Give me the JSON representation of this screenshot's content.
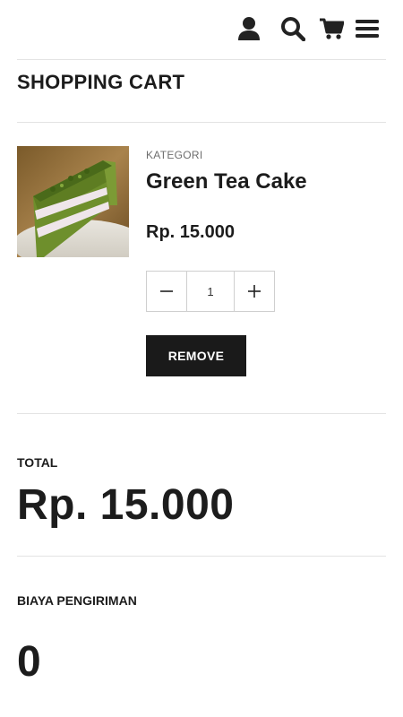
{
  "header": {
    "icons": [
      "user-icon",
      "search-icon",
      "cart-icon",
      "menu-icon"
    ]
  },
  "page_title": "SHOPPING CART",
  "cart_item": {
    "category": "KATEGORI",
    "name": "Green Tea Cake",
    "price": "Rp. 15.000",
    "quantity": "1",
    "remove_label": "REMOVE"
  },
  "summary": {
    "total_label": "TOTAL",
    "total_value": "Rp. 15.000",
    "shipping_label": "BIAYA PENGIRIMAN",
    "shipping_value": "0"
  },
  "colors": {
    "text": "#1c1c1c",
    "button_bg": "#1a1a1a",
    "divider": "#e3e3e3"
  }
}
